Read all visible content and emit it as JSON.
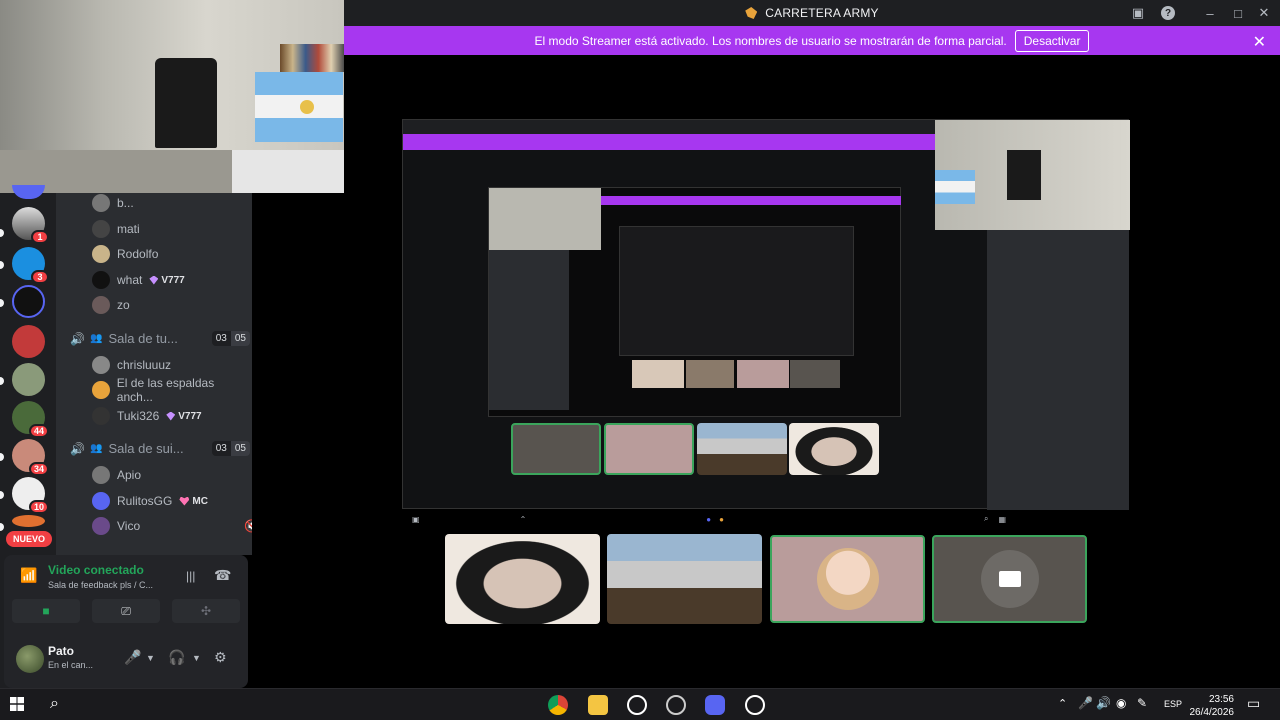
{
  "window": {
    "title": "CARRETERA ARMY"
  },
  "streamer": {
    "message": "El modo Streamer está activado. Los nombres de usuario se mostrarán de forma parcial.",
    "button": "Desactivar"
  },
  "rail": {
    "badges": [
      "1",
      "3",
      "44",
      "34",
      "10"
    ],
    "new_label": "NUEVO"
  },
  "channels": {
    "users_top": [
      {
        "name": "b..."
      },
      {
        "name": "mati"
      },
      {
        "name": "Rodolfo"
      },
      {
        "name": "what",
        "tag": "V777"
      },
      {
        "name": "zo"
      }
    ],
    "room1": {
      "name": "Sala de tu...",
      "count_a": "03",
      "count_b": "05"
    },
    "room1_users": [
      {
        "name": "chrisluuuz"
      },
      {
        "name": "El de las espaldas anch..."
      },
      {
        "name": "Tuki326",
        "tag": "V777"
      }
    ],
    "room2": {
      "name": "Sala de sui...",
      "count_a": "03",
      "count_b": "05"
    },
    "room2_users": [
      {
        "name": "Apio"
      },
      {
        "name": "RulitosGG",
        "tag": "MC"
      },
      {
        "name": "Vico"
      }
    ]
  },
  "voice": {
    "status": "Video conectado",
    "channel": "Sala de feedback pls / C..."
  },
  "user": {
    "name": "Pato",
    "status": "En el can..."
  },
  "clock": {
    "time": "23:56",
    "date": "26/4/2026",
    "lang": "ESP"
  },
  "colors": {
    "accent": "#a737f0",
    "green": "#23a55a",
    "red": "#f23f43",
    "bg": "#2b2d31"
  }
}
